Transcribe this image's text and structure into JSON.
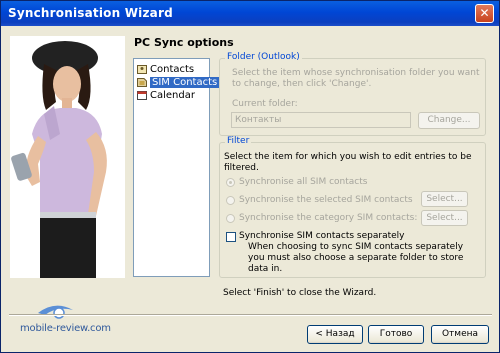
{
  "window": {
    "title": "Synchronisation Wizard",
    "close_glyph": "✕"
  },
  "page": {
    "heading": "PC Sync options"
  },
  "sources": [
    {
      "label": "Contacts",
      "icon": "contacts-book-icon",
      "selected": false
    },
    {
      "label": "SIM Contacts",
      "icon": "sim-card-icon",
      "selected": true
    },
    {
      "label": "Calendar",
      "icon": "calendar-icon",
      "selected": false
    }
  ],
  "folder": {
    "title": "Folder (Outlook)",
    "description": "Select the item whose synchronisation folder you want to change, then click 'Change'.",
    "current_label": "Current folder:",
    "current_value": "Контакты",
    "change_button": "Change..."
  },
  "filter": {
    "title": "Filter",
    "description": "Select the item for which you wish to edit entries to be filtered.",
    "options": [
      {
        "label": "Synchronise all SIM contacts",
        "checked": true
      },
      {
        "label": "Synchronise the selected SIM contacts",
        "checked": false,
        "button": "Select..."
      },
      {
        "label": "Synchronise the category SIM contacts:",
        "checked": false,
        "button": "Select..."
      }
    ],
    "separate_label": "Synchronise SIM contacts separately",
    "separate_checked": false,
    "separate_note": "When choosing to sync SIM contacts separately you must also choose a separate folder to store data in."
  },
  "finish_hint": "Select 'Finish' to close the Wizard.",
  "watermark": {
    "text": "mobile-review.com"
  },
  "buttons": {
    "back": "< Назад",
    "finish": "Готово",
    "cancel": "Отмена"
  },
  "colors": {
    "title_bar": "#0046d5",
    "selection": "#316ac5",
    "group_title": "#0046d5",
    "window_bg": "#ece9d8"
  }
}
